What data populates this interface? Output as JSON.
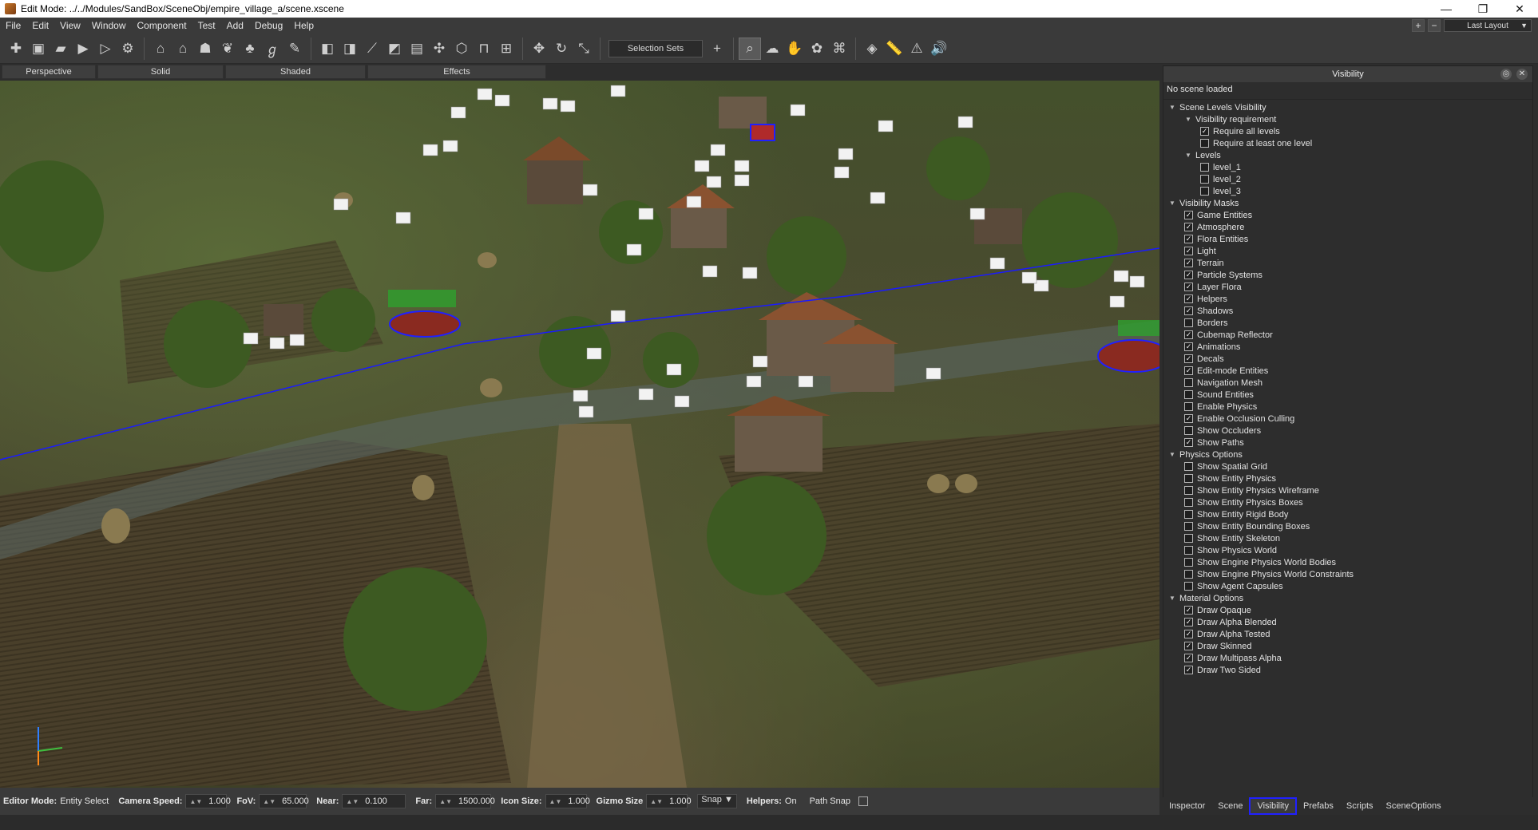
{
  "window": {
    "title": "Edit Mode: ../../Modules/SandBox/SceneObj/empire_village_a/scene.xscene",
    "minimize": "—",
    "maximize": "❐",
    "close": "✕"
  },
  "menu": [
    "File",
    "Edit",
    "View",
    "Window",
    "Component",
    "Test",
    "Add",
    "Debug",
    "Help"
  ],
  "menu_right": {
    "plus": "+",
    "minus": "−",
    "layout": "Last Layout"
  },
  "toolbar": {
    "selection_sets": "Selection Sets",
    "add": "+"
  },
  "view_modes": [
    "Perspective",
    "Solid",
    "Shaded",
    "Effects"
  ],
  "status": {
    "editor_mode_label": "Editor Mode:",
    "editor_mode_value": "Entity Select",
    "camera_speed_label": "Camera Speed:",
    "camera_speed": "1.000",
    "fov_label": "FoV:",
    "fov": "65.000",
    "near_label": "Near:",
    "near": "0.100",
    "far_label": "Far:",
    "far": "1500.000",
    "icon_size_label": "Icon Size:",
    "icon_size": "1.000",
    "gizmo_size_label": "Gizmo Size",
    "gizmo_size": "1.000",
    "snap": "Snap ▼",
    "helpers_label": "Helpers:",
    "helpers_value": "On",
    "path_snap": "Path Snap"
  },
  "panel": {
    "title": "Visibility",
    "no_scene": "No scene loaded",
    "tree": [
      {
        "type": "group",
        "indent": 0,
        "label": "Scene Levels Visibility"
      },
      {
        "type": "group",
        "indent": 1,
        "label": "Visibility requirement"
      },
      {
        "type": "check",
        "indent": 2,
        "label": "Require all levels",
        "checked": true
      },
      {
        "type": "check",
        "indent": 2,
        "label": "Require at least one level",
        "checked": false
      },
      {
        "type": "group",
        "indent": 1,
        "label": "Levels"
      },
      {
        "type": "check",
        "indent": 2,
        "label": "level_1",
        "checked": false
      },
      {
        "type": "check",
        "indent": 2,
        "label": "level_2",
        "checked": false
      },
      {
        "type": "check",
        "indent": 2,
        "label": "level_3",
        "checked": false
      },
      {
        "type": "group",
        "indent": 0,
        "label": "Visibility Masks"
      },
      {
        "type": "check",
        "indent": 1,
        "label": "Game Entities",
        "checked": true
      },
      {
        "type": "check",
        "indent": 1,
        "label": "Atmosphere",
        "checked": true
      },
      {
        "type": "check",
        "indent": 1,
        "label": "Flora Entities",
        "checked": true
      },
      {
        "type": "check",
        "indent": 1,
        "label": "Light",
        "checked": true
      },
      {
        "type": "check",
        "indent": 1,
        "label": "Terrain",
        "checked": true
      },
      {
        "type": "check",
        "indent": 1,
        "label": "Particle Systems",
        "checked": true
      },
      {
        "type": "check",
        "indent": 1,
        "label": "Layer Flora",
        "checked": true
      },
      {
        "type": "check",
        "indent": 1,
        "label": "Helpers",
        "checked": true
      },
      {
        "type": "check",
        "indent": 1,
        "label": "Shadows",
        "checked": true
      },
      {
        "type": "check",
        "indent": 1,
        "label": "Borders",
        "checked": false
      },
      {
        "type": "check",
        "indent": 1,
        "label": "Cubemap Reflector",
        "checked": true
      },
      {
        "type": "check",
        "indent": 1,
        "label": "Animations",
        "checked": true
      },
      {
        "type": "check",
        "indent": 1,
        "label": "Decals",
        "checked": true
      },
      {
        "type": "check",
        "indent": 1,
        "label": "Edit-mode Entities",
        "checked": true
      },
      {
        "type": "check",
        "indent": 1,
        "label": "Navigation Mesh",
        "checked": false
      },
      {
        "type": "check",
        "indent": 1,
        "label": "Sound Entities",
        "checked": false
      },
      {
        "type": "check",
        "indent": 1,
        "label": "Enable Physics",
        "checked": false
      },
      {
        "type": "check",
        "indent": 1,
        "label": "Enable Occlusion Culling",
        "checked": true
      },
      {
        "type": "check",
        "indent": 1,
        "label": "Show Occluders",
        "checked": false
      },
      {
        "type": "check",
        "indent": 1,
        "label": "Show Paths",
        "checked": true
      },
      {
        "type": "group",
        "indent": 0,
        "label": "Physics Options"
      },
      {
        "type": "check",
        "indent": 1,
        "label": "Show Spatial Grid",
        "checked": false
      },
      {
        "type": "check",
        "indent": 1,
        "label": "Show Entity Physics",
        "checked": false
      },
      {
        "type": "check",
        "indent": 1,
        "label": "Show Entity Physics Wireframe",
        "checked": false
      },
      {
        "type": "check",
        "indent": 1,
        "label": "Show Entity Physics Boxes",
        "checked": false
      },
      {
        "type": "check",
        "indent": 1,
        "label": "Show Entity Rigid Body",
        "checked": false
      },
      {
        "type": "check",
        "indent": 1,
        "label": "Show Entity Bounding Boxes",
        "checked": false
      },
      {
        "type": "check",
        "indent": 1,
        "label": "Show Entity Skeleton",
        "checked": false
      },
      {
        "type": "check",
        "indent": 1,
        "label": "Show Physics World",
        "checked": false
      },
      {
        "type": "check",
        "indent": 1,
        "label": "Show Engine Physics World Bodies",
        "checked": false
      },
      {
        "type": "check",
        "indent": 1,
        "label": "Show Engine Physics World Constraints",
        "checked": false
      },
      {
        "type": "check",
        "indent": 1,
        "label": "Show Agent Capsules",
        "checked": false
      },
      {
        "type": "group",
        "indent": 0,
        "label": "Material Options"
      },
      {
        "type": "check",
        "indent": 1,
        "label": "Draw Opaque",
        "checked": true
      },
      {
        "type": "check",
        "indent": 1,
        "label": "Draw Alpha Blended",
        "checked": true
      },
      {
        "type": "check",
        "indent": 1,
        "label": "Draw Alpha Tested",
        "checked": true
      },
      {
        "type": "check",
        "indent": 1,
        "label": "Draw Skinned",
        "checked": true
      },
      {
        "type": "check",
        "indent": 1,
        "label": "Draw Multipass Alpha",
        "checked": true
      },
      {
        "type": "check",
        "indent": 1,
        "label": "Draw Two Sided",
        "checked": true
      }
    ]
  },
  "tabs": [
    {
      "label": "Inspector",
      "active": false
    },
    {
      "label": "Scene",
      "active": false
    },
    {
      "label": "Visibility",
      "active": true
    },
    {
      "label": "Prefabs",
      "active": false
    },
    {
      "label": "Scripts",
      "active": false
    },
    {
      "label": "SceneOptions",
      "active": false
    }
  ],
  "colors": {
    "active_tab_border": "#2020ff",
    "path_line": "#1a1aff",
    "gizmo_y": "#2f7fff",
    "gizmo_x": "#3fbf3f",
    "gizmo_z": "#ff8a1a"
  }
}
